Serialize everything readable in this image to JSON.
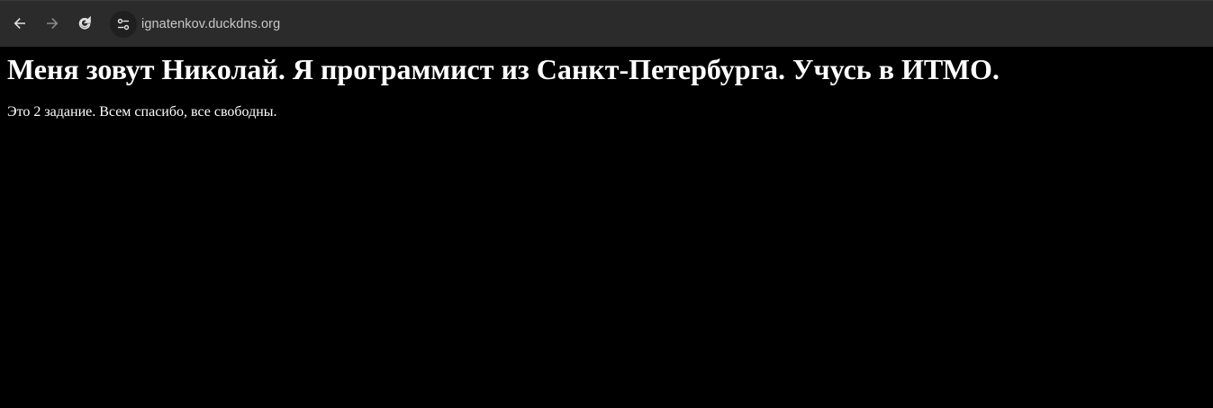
{
  "browser": {
    "url": "ignatenkov.duckdns.org",
    "icons": {
      "back": "arrow-left-icon",
      "forward": "arrow-right-icon",
      "reload": "reload-icon",
      "site_info": "tune-icon"
    },
    "colors": {
      "toolbar_bg": "#2b2b2b",
      "icon": "#e3e3e3",
      "icon_disabled": "#8a8a8a",
      "url_text": "#c8c8c8"
    }
  },
  "page": {
    "heading": "Меня зовут Николай. Я программист из Санкт-Петербурга. Учусь в ИТМО.",
    "paragraph": "Это 2 задание. Всем спасибо, все свободны.",
    "colors": {
      "background": "#000000",
      "text": "#ffffff"
    }
  }
}
